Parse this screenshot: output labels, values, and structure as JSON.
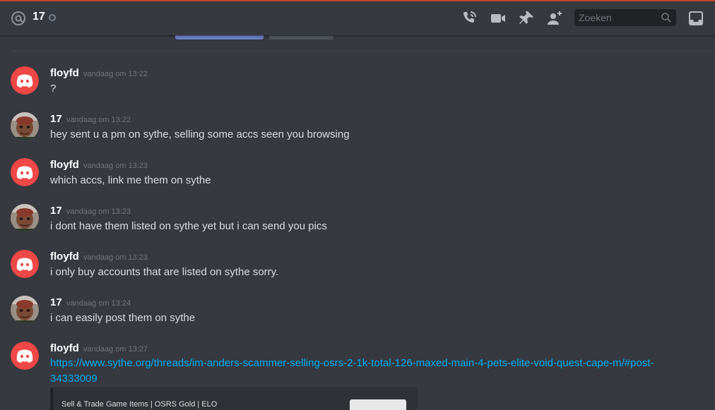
{
  "header": {
    "channel_name": "17",
    "search_placeholder": "Zoeken",
    "accent_color": "#c0452c",
    "icons": [
      "at-icon",
      "call-icon",
      "video-icon",
      "pin-icon",
      "add-friend-icon",
      "search-icon",
      "inbox-icon"
    ]
  },
  "messages": [
    {
      "author": "floyfd",
      "time": "vandaag om 13:22",
      "text": "?",
      "avatar": "discord-logo"
    },
    {
      "author": "17",
      "time": "vandaag om 13:22",
      "text": "hey sent u a pm on sythe, selling some accs seen you browsing",
      "avatar": "user-photo"
    },
    {
      "author": "floyfd",
      "time": "vandaag om 13:23",
      "text": "which accs, link me them on sythe",
      "avatar": "discord-logo"
    },
    {
      "author": "17",
      "time": "vandaag om 13:23",
      "text": "i dont have them listed on sythe yet but i can send you pics",
      "avatar": "user-photo"
    },
    {
      "author": "floyfd",
      "time": "vandaag om 13:23",
      "text": "i only buy accounts that are listed on sythe sorry.",
      "avatar": "discord-logo"
    },
    {
      "author": "17",
      "time": "vandaag om 13:24",
      "text": "i can easily post them on sythe",
      "avatar": "user-photo"
    },
    {
      "author": "floyfd",
      "time": "vandaag om 13:27",
      "text": "https://www.sythe.org/threads/im-anders-scammer-selling-osrs-2-1k-total-126-maxed-main-4-pets-elite-void-quest-cape-m/#post-34333009",
      "avatar": "discord-logo"
    }
  ],
  "embed": {
    "provider": "Sell & Trade Game Items | OSRS Gold | ELO"
  },
  "colors": {
    "background": "#36393f",
    "discord_red": "#f04747",
    "link": "#00b0f4",
    "muted": "#72767d"
  }
}
